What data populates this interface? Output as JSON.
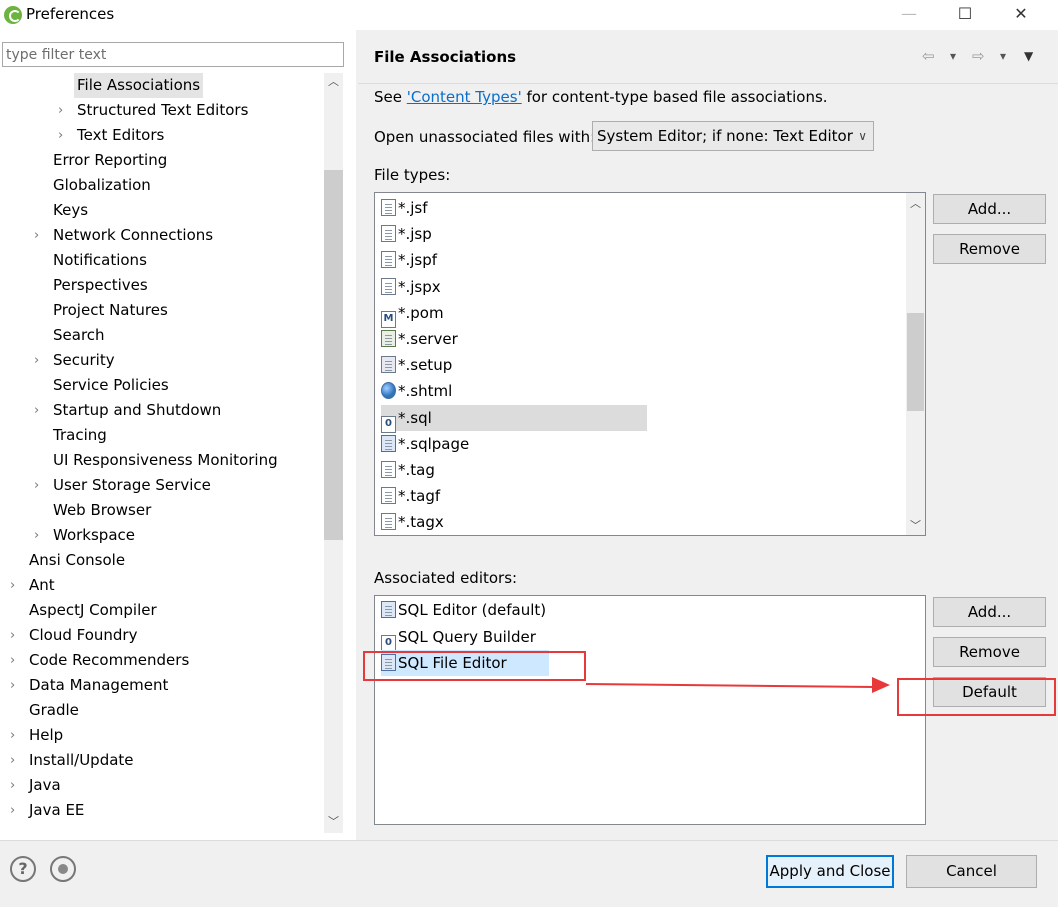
{
  "window": {
    "title": "Preferences",
    "minimize_glyph": "—",
    "maximize_glyph": "☐",
    "close_glyph": "✕"
  },
  "filter": {
    "placeholder": "type filter text",
    "value": ""
  },
  "tree": {
    "items": [
      {
        "label": "File Associations",
        "chevron": "",
        "selected": true
      },
      {
        "label": "Structured Text Editors",
        "chevron": "›"
      },
      {
        "label": "Text Editors",
        "chevron": "›"
      },
      {
        "label": "Error Reporting",
        "chevron": ""
      },
      {
        "label": "Globalization",
        "chevron": ""
      },
      {
        "label": "Keys",
        "chevron": ""
      },
      {
        "label": "Network Connections",
        "chevron": "›"
      },
      {
        "label": "Notifications",
        "chevron": ""
      },
      {
        "label": "Perspectives",
        "chevron": ""
      },
      {
        "label": "Project Natures",
        "chevron": ""
      },
      {
        "label": "Search",
        "chevron": ""
      },
      {
        "label": "Security",
        "chevron": "›"
      },
      {
        "label": "Service Policies",
        "chevron": ""
      },
      {
        "label": "Startup and Shutdown",
        "chevron": "›"
      },
      {
        "label": "Tracing",
        "chevron": ""
      },
      {
        "label": "UI Responsiveness Monitoring",
        "chevron": ""
      },
      {
        "label": "User Storage Service",
        "chevron": "›"
      },
      {
        "label": "Web Browser",
        "chevron": ""
      },
      {
        "label": "Workspace",
        "chevron": "›"
      },
      {
        "label": "Ansi Console",
        "chevron": ""
      },
      {
        "label": "Ant",
        "chevron": "›"
      },
      {
        "label": "AspectJ Compiler",
        "chevron": ""
      },
      {
        "label": "Cloud Foundry",
        "chevron": "›"
      },
      {
        "label": "Code Recommenders",
        "chevron": "›"
      },
      {
        "label": "Data Management",
        "chevron": "›"
      },
      {
        "label": "Gradle",
        "chevron": ""
      },
      {
        "label": "Help",
        "chevron": "›"
      },
      {
        "label": "Install/Update",
        "chevron": "›"
      },
      {
        "label": "Java",
        "chevron": "›"
      },
      {
        "label": "Java EE",
        "chevron": "›"
      }
    ]
  },
  "page": {
    "title": "File Associations",
    "nav": {
      "back": "⇦",
      "back_menu": "▾",
      "forward": "⇨",
      "forward_menu": "▾",
      "view_menu": "▼"
    },
    "see_prefix": "See ",
    "see_link": "'Content Types'",
    "see_suffix": " for content-type based file associations.",
    "open_label": "Open unassociated files with:",
    "open_value": "System Editor; if none: Text Editor",
    "file_types_label": "File types:",
    "file_types": [
      {
        "name": "*.jsf",
        "icon": "doc"
      },
      {
        "name": "*.jsp",
        "icon": "doc"
      },
      {
        "name": "*.jspf",
        "icon": "doc"
      },
      {
        "name": "*.jspx",
        "icon": "doc"
      },
      {
        "name": "*.pom",
        "icon": "maven"
      },
      {
        "name": "*.server",
        "icon": "server"
      },
      {
        "name": "*.setup",
        "icon": "setup"
      },
      {
        "name": "*.shtml",
        "icon": "globe"
      },
      {
        "name": "*.sql",
        "icon": "sql",
        "selected": true
      },
      {
        "name": "*.sqlpage",
        "icon": "sqlpage"
      },
      {
        "name": "*.tag",
        "icon": "doc"
      },
      {
        "name": "*.tagf",
        "icon": "doc"
      },
      {
        "name": "*.tagx",
        "icon": "doc"
      }
    ],
    "file_types_buttons": {
      "add": "Add...",
      "remove": "Remove"
    },
    "editors_label": "Associated editors:",
    "editors": [
      {
        "name": "SQL Editor (default)",
        "icon": "sqlpage"
      },
      {
        "name": "SQL Query Builder",
        "icon": "sql"
      },
      {
        "name": "SQL File Editor",
        "icon": "sqlpage",
        "highlighted": true
      }
    ],
    "editors_buttons": {
      "add": "Add...",
      "remove": "Remove",
      "default": "Default"
    }
  },
  "bottom": {
    "help_glyph": "?",
    "apply_close": "Apply and Close",
    "cancel": "Cancel"
  },
  "icon_glyphs": {
    "maven": "M",
    "sql": "0"
  },
  "colors": {
    "annotation": "#e8393a",
    "link": "#0b6ec9",
    "primary_border": "#0078d7"
  }
}
